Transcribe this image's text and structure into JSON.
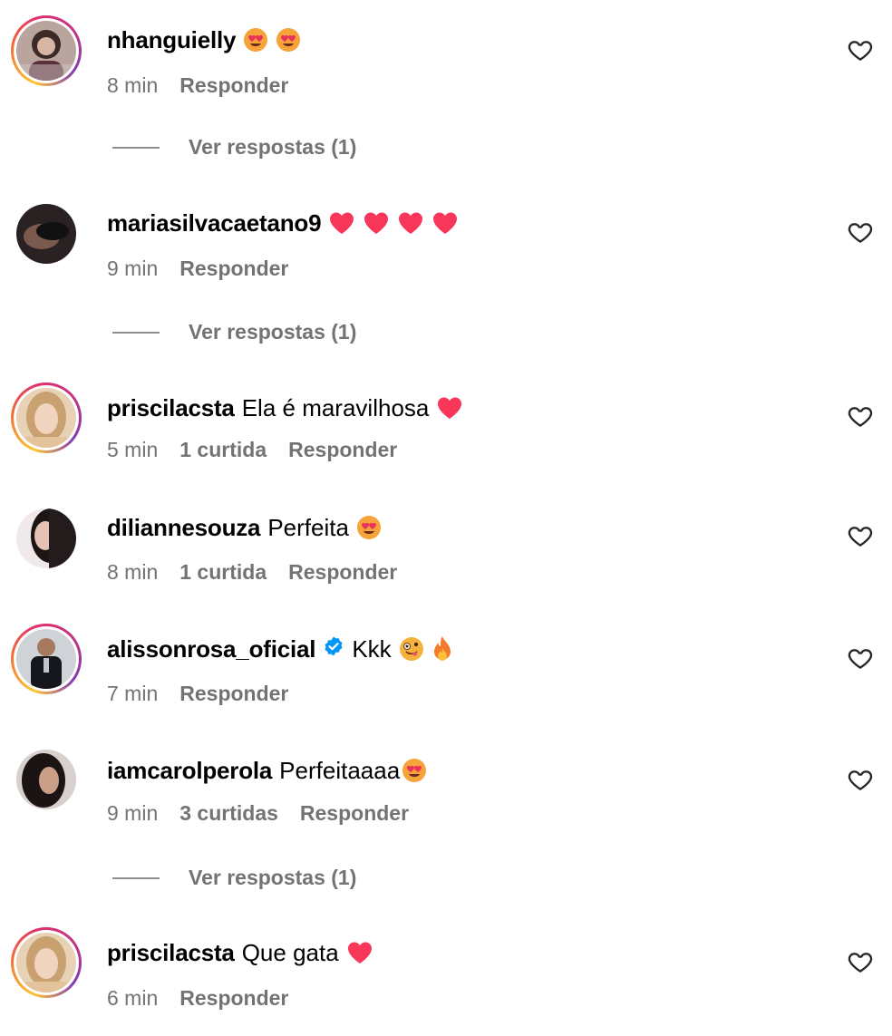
{
  "comments": [
    {
      "username": "nhanguielly",
      "text": "",
      "emojis": [
        "heart-eyes-emoji",
        "heart-eyes-emoji"
      ],
      "time": "8 min",
      "likes": "",
      "reply_label": "Responder",
      "view_replies": "Ver respostas (1)",
      "verified": false
    },
    {
      "username": "mariasilvacaetano9",
      "text": "",
      "emojis": [
        "red-heart-emoji",
        "red-heart-emoji",
        "red-heart-emoji",
        "red-heart-emoji"
      ],
      "time": "9 min",
      "likes": "",
      "reply_label": "Responder",
      "view_replies": "Ver respostas (1)",
      "verified": false
    },
    {
      "username": "priscilacsta",
      "text": "Ela é maravilhosa",
      "emojis": [
        "red-heart-emoji"
      ],
      "time": "5 min",
      "likes": "1 curtida",
      "reply_label": "Responder",
      "view_replies": "",
      "verified": false
    },
    {
      "username": "diliannesouza",
      "text": "Perfeita",
      "emojis": [
        "heart-eyes-emoji"
      ],
      "time": "8 min",
      "likes": "1 curtida",
      "reply_label": "Responder",
      "view_replies": "",
      "verified": false
    },
    {
      "username": "alissonrosa_oficial",
      "text": "Kkk",
      "emojis": [
        "zany-face-emoji",
        "fire-emoji"
      ],
      "time": "7 min",
      "likes": "",
      "reply_label": "Responder",
      "view_replies": "",
      "verified": true
    },
    {
      "username": "iamcarolperola",
      "text": "Perfeitaaaa",
      "emojis": [
        "heart-eyes-emoji"
      ],
      "time": "9 min",
      "likes": "3 curtidas",
      "reply_label": "Responder",
      "view_replies": "Ver respostas (1)",
      "verified": false
    },
    {
      "username": "priscilacsta",
      "text": "Que gata",
      "emojis": [
        "red-heart-emoji"
      ],
      "time": "6 min",
      "likes": "",
      "reply_label": "Responder",
      "view_replies": "",
      "verified": false
    }
  ],
  "colors": {
    "meta_gray": "#737373",
    "heart_red": "#f7365a",
    "verified_blue": "#0095f6"
  }
}
